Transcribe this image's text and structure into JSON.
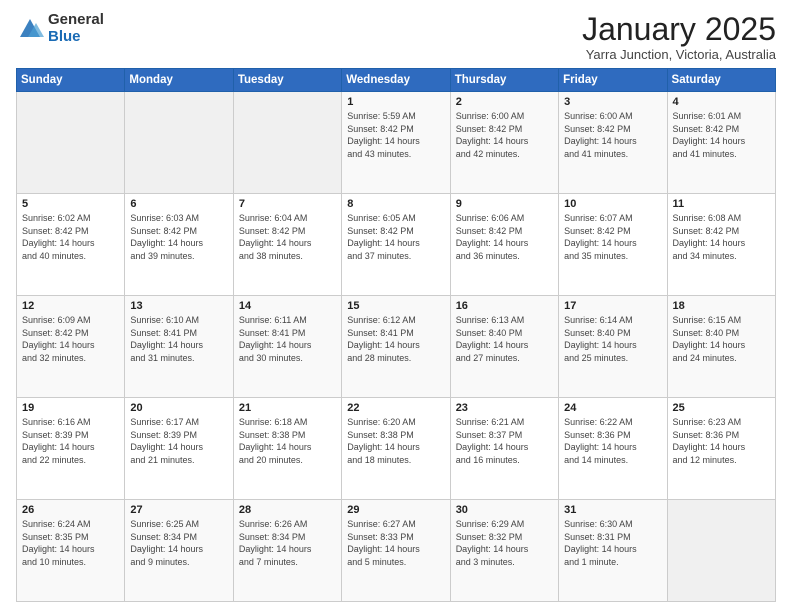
{
  "logo": {
    "general": "General",
    "blue": "Blue"
  },
  "title": {
    "month": "January 2025",
    "location": "Yarra Junction, Victoria, Australia"
  },
  "weekdays": [
    "Sunday",
    "Monday",
    "Tuesday",
    "Wednesday",
    "Thursday",
    "Friday",
    "Saturday"
  ],
  "weeks": [
    [
      {
        "day": "",
        "info": ""
      },
      {
        "day": "",
        "info": ""
      },
      {
        "day": "",
        "info": ""
      },
      {
        "day": "1",
        "info": "Sunrise: 5:59 AM\nSunset: 8:42 PM\nDaylight: 14 hours\nand 43 minutes."
      },
      {
        "day": "2",
        "info": "Sunrise: 6:00 AM\nSunset: 8:42 PM\nDaylight: 14 hours\nand 42 minutes."
      },
      {
        "day": "3",
        "info": "Sunrise: 6:00 AM\nSunset: 8:42 PM\nDaylight: 14 hours\nand 41 minutes."
      },
      {
        "day": "4",
        "info": "Sunrise: 6:01 AM\nSunset: 8:42 PM\nDaylight: 14 hours\nand 41 minutes."
      }
    ],
    [
      {
        "day": "5",
        "info": "Sunrise: 6:02 AM\nSunset: 8:42 PM\nDaylight: 14 hours\nand 40 minutes."
      },
      {
        "day": "6",
        "info": "Sunrise: 6:03 AM\nSunset: 8:42 PM\nDaylight: 14 hours\nand 39 minutes."
      },
      {
        "day": "7",
        "info": "Sunrise: 6:04 AM\nSunset: 8:42 PM\nDaylight: 14 hours\nand 38 minutes."
      },
      {
        "day": "8",
        "info": "Sunrise: 6:05 AM\nSunset: 8:42 PM\nDaylight: 14 hours\nand 37 minutes."
      },
      {
        "day": "9",
        "info": "Sunrise: 6:06 AM\nSunset: 8:42 PM\nDaylight: 14 hours\nand 36 minutes."
      },
      {
        "day": "10",
        "info": "Sunrise: 6:07 AM\nSunset: 8:42 PM\nDaylight: 14 hours\nand 35 minutes."
      },
      {
        "day": "11",
        "info": "Sunrise: 6:08 AM\nSunset: 8:42 PM\nDaylight: 14 hours\nand 34 minutes."
      }
    ],
    [
      {
        "day": "12",
        "info": "Sunrise: 6:09 AM\nSunset: 8:42 PM\nDaylight: 14 hours\nand 32 minutes."
      },
      {
        "day": "13",
        "info": "Sunrise: 6:10 AM\nSunset: 8:41 PM\nDaylight: 14 hours\nand 31 minutes."
      },
      {
        "day": "14",
        "info": "Sunrise: 6:11 AM\nSunset: 8:41 PM\nDaylight: 14 hours\nand 30 minutes."
      },
      {
        "day": "15",
        "info": "Sunrise: 6:12 AM\nSunset: 8:41 PM\nDaylight: 14 hours\nand 28 minutes."
      },
      {
        "day": "16",
        "info": "Sunrise: 6:13 AM\nSunset: 8:40 PM\nDaylight: 14 hours\nand 27 minutes."
      },
      {
        "day": "17",
        "info": "Sunrise: 6:14 AM\nSunset: 8:40 PM\nDaylight: 14 hours\nand 25 minutes."
      },
      {
        "day": "18",
        "info": "Sunrise: 6:15 AM\nSunset: 8:40 PM\nDaylight: 14 hours\nand 24 minutes."
      }
    ],
    [
      {
        "day": "19",
        "info": "Sunrise: 6:16 AM\nSunset: 8:39 PM\nDaylight: 14 hours\nand 22 minutes."
      },
      {
        "day": "20",
        "info": "Sunrise: 6:17 AM\nSunset: 8:39 PM\nDaylight: 14 hours\nand 21 minutes."
      },
      {
        "day": "21",
        "info": "Sunrise: 6:18 AM\nSunset: 8:38 PM\nDaylight: 14 hours\nand 20 minutes."
      },
      {
        "day": "22",
        "info": "Sunrise: 6:20 AM\nSunset: 8:38 PM\nDaylight: 14 hours\nand 18 minutes."
      },
      {
        "day": "23",
        "info": "Sunrise: 6:21 AM\nSunset: 8:37 PM\nDaylight: 14 hours\nand 16 minutes."
      },
      {
        "day": "24",
        "info": "Sunrise: 6:22 AM\nSunset: 8:36 PM\nDaylight: 14 hours\nand 14 minutes."
      },
      {
        "day": "25",
        "info": "Sunrise: 6:23 AM\nSunset: 8:36 PM\nDaylight: 14 hours\nand 12 minutes."
      }
    ],
    [
      {
        "day": "26",
        "info": "Sunrise: 6:24 AM\nSunset: 8:35 PM\nDaylight: 14 hours\nand 10 minutes."
      },
      {
        "day": "27",
        "info": "Sunrise: 6:25 AM\nSunset: 8:34 PM\nDaylight: 14 hours\nand 9 minutes."
      },
      {
        "day": "28",
        "info": "Sunrise: 6:26 AM\nSunset: 8:34 PM\nDaylight: 14 hours\nand 7 minutes."
      },
      {
        "day": "29",
        "info": "Sunrise: 6:27 AM\nSunset: 8:33 PM\nDaylight: 14 hours\nand 5 minutes."
      },
      {
        "day": "30",
        "info": "Sunrise: 6:29 AM\nSunset: 8:32 PM\nDaylight: 14 hours\nand 3 minutes."
      },
      {
        "day": "31",
        "info": "Sunrise: 6:30 AM\nSunset: 8:31 PM\nDaylight: 14 hours\nand 1 minute."
      },
      {
        "day": "",
        "info": ""
      }
    ]
  ]
}
